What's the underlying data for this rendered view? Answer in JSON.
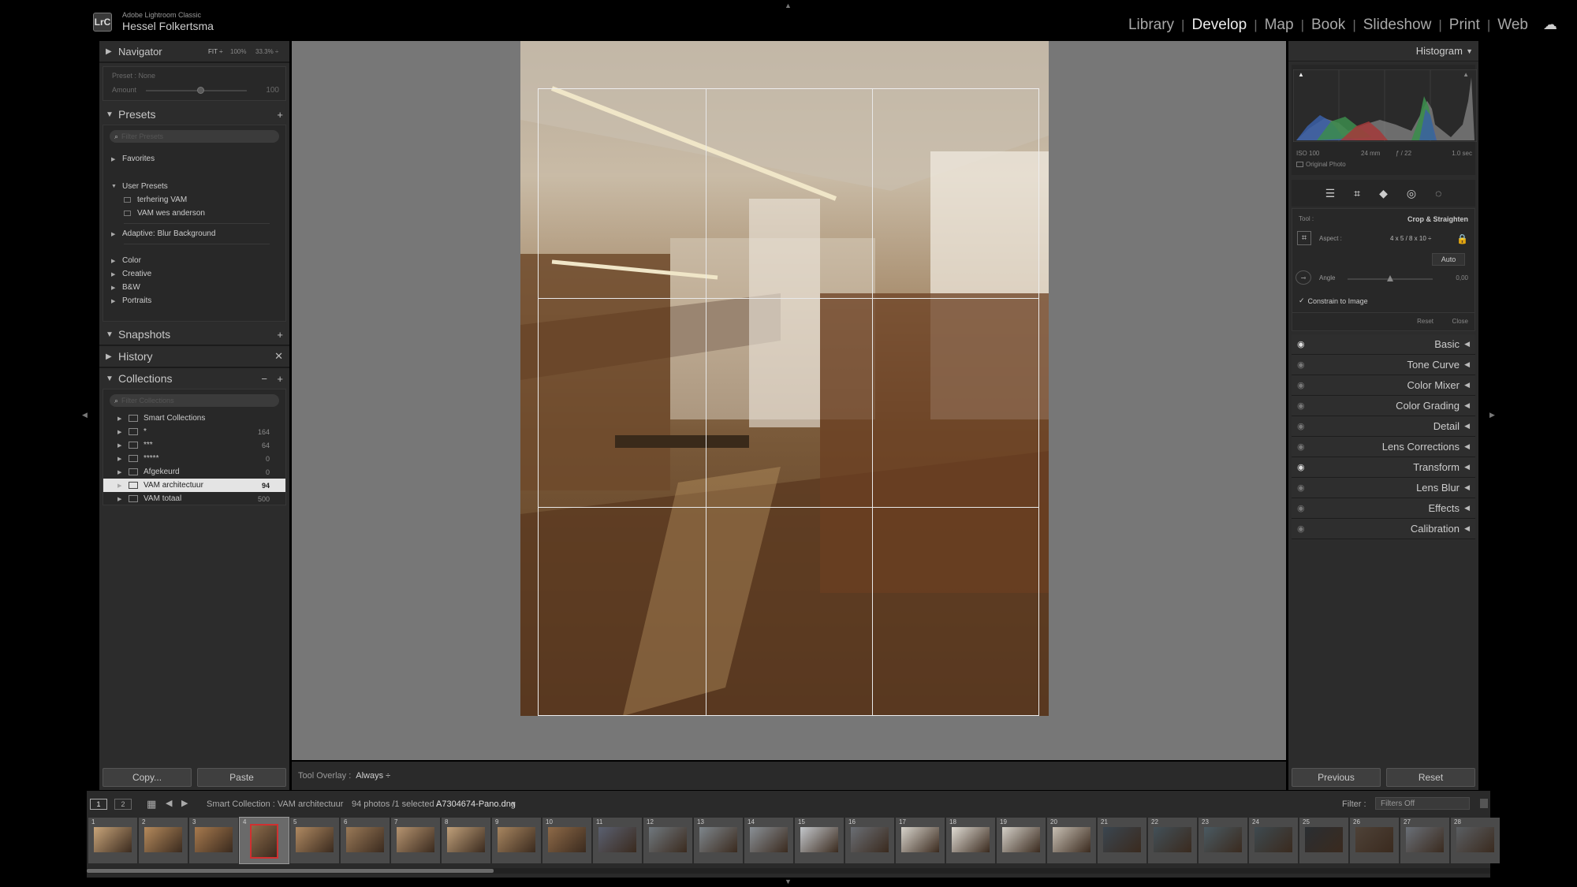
{
  "app": {
    "logo": "LrC",
    "product": "Adobe Lightroom Classic",
    "user": "Hessel Folkertsma"
  },
  "modules": [
    {
      "label": "Library",
      "active": false
    },
    {
      "label": "Develop",
      "active": true
    },
    {
      "label": "Map",
      "active": false
    },
    {
      "label": "Book",
      "active": false
    },
    {
      "label": "Slideshow",
      "active": false
    },
    {
      "label": "Print",
      "active": false
    },
    {
      "label": "Web",
      "active": false
    }
  ],
  "left": {
    "navigator": {
      "title": "Navigator",
      "fit": "FIT ÷",
      "z1": "100%",
      "z2": "33.3% ÷"
    },
    "preset_amount": {
      "preset_label": "Preset : None",
      "amount_label": "Amount",
      "amount_value": "100",
      "amount_level": 0.55
    },
    "presets": {
      "title": "Presets",
      "filter_placeholder": "Filter Presets",
      "favorites": "Favorites",
      "user_presets": "User Presets",
      "user_items": [
        "terhering VAM",
        "VAM wes anderson"
      ],
      "adaptive": "Adaptive: Blur Background",
      "groups": [
        "Color",
        "Creative",
        "B&W",
        "Portraits"
      ]
    },
    "snapshots": {
      "title": "Snapshots"
    },
    "history": {
      "title": "History"
    },
    "collections": {
      "title": "Collections",
      "filter_placeholder": "Filter Collections",
      "items": [
        {
          "name": "Smart Collections",
          "count": "",
          "selected": false,
          "folder": true
        },
        {
          "name": "*",
          "count": "164",
          "selected": false
        },
        {
          "name": "***",
          "count": "64",
          "selected": false
        },
        {
          "name": "*****",
          "count": "0",
          "selected": false
        },
        {
          "name": "Afgekeurd",
          "count": "0",
          "selected": false
        },
        {
          "name": "VAM architectuur",
          "count": "94",
          "selected": true
        },
        {
          "name": "VAM totaal",
          "count": "500",
          "selected": false
        }
      ]
    },
    "copy_label": "Copy...",
    "paste_label": "Paste"
  },
  "toolbar": {
    "overlay_label": "Tool Overlay :",
    "overlay_value": "Always ÷"
  },
  "right": {
    "histogram": {
      "title": "Histogram",
      "iso": "ISO 100",
      "focal": "24 mm",
      "aperture": "ƒ / 22",
      "shutter": "1.0 sec",
      "original_photo": "Original Photo"
    },
    "crop": {
      "tool_label": "Tool :",
      "tool_value": "Crop & Straighten",
      "aspect_label": "Aspect :",
      "aspect_value": "4 x 5  /  8 x 10  ÷",
      "auto_label": "Auto",
      "angle_label": "Angle",
      "angle_value": "0,00",
      "angle_level": 0.5,
      "constrain_label": "Constrain to Image",
      "reset_label": "Reset",
      "close_label": "Close"
    },
    "sections": [
      {
        "label": "Basic",
        "eye": true
      },
      {
        "label": "Tone Curve",
        "eye": false
      },
      {
        "label": "Color Mixer",
        "eye": false
      },
      {
        "label": "Color Grading",
        "eye": false
      },
      {
        "label": "Detail",
        "eye": false
      },
      {
        "label": "Lens Corrections",
        "eye": false
      },
      {
        "label": "Transform",
        "eye": true
      },
      {
        "label": "Lens Blur",
        "eye": false
      },
      {
        "label": "Effects",
        "eye": false
      },
      {
        "label": "Calibration",
        "eye": false
      }
    ],
    "previous_label": "Previous",
    "reset_label": "Reset"
  },
  "filmstrip": {
    "page1": "1",
    "page2": "2",
    "source": "Smart Collection : VAM architectuur",
    "count_text": "94 photos /1 selected /",
    "filename": "A7304674-Pano.dng",
    "filter_label": "Filter :",
    "filter_value": "Filters Off",
    "thumbs": [
      "1",
      "2",
      "3",
      "4",
      "5",
      "6",
      "7",
      "8",
      "9",
      "10",
      "11",
      "12",
      "13",
      "14",
      "15",
      "16",
      "17",
      "18",
      "19",
      "20",
      "21",
      "22",
      "23",
      "24",
      "25",
      "26",
      "27",
      "28"
    ],
    "selected_index": 3,
    "scroll_fraction": 0.29
  }
}
